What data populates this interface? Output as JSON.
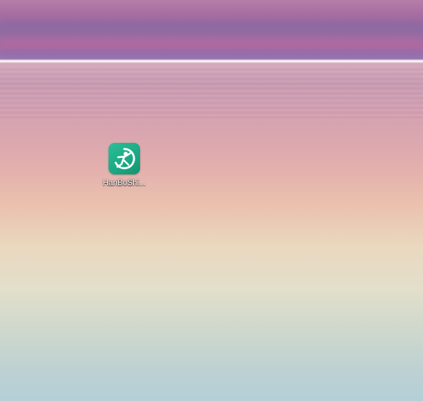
{
  "desktop": {
    "wallpaper": {
      "colors": {
        "sky_top": "#b47ea9",
        "horizon": "#f5e9ef",
        "mid": "#eac2ae",
        "bottom": "#b4cfd8"
      }
    },
    "icons": [
      {
        "label": "HanBoShi...",
        "icon": "hanboshi-app-icon",
        "tile_color": "#1fae87"
      }
    ]
  }
}
